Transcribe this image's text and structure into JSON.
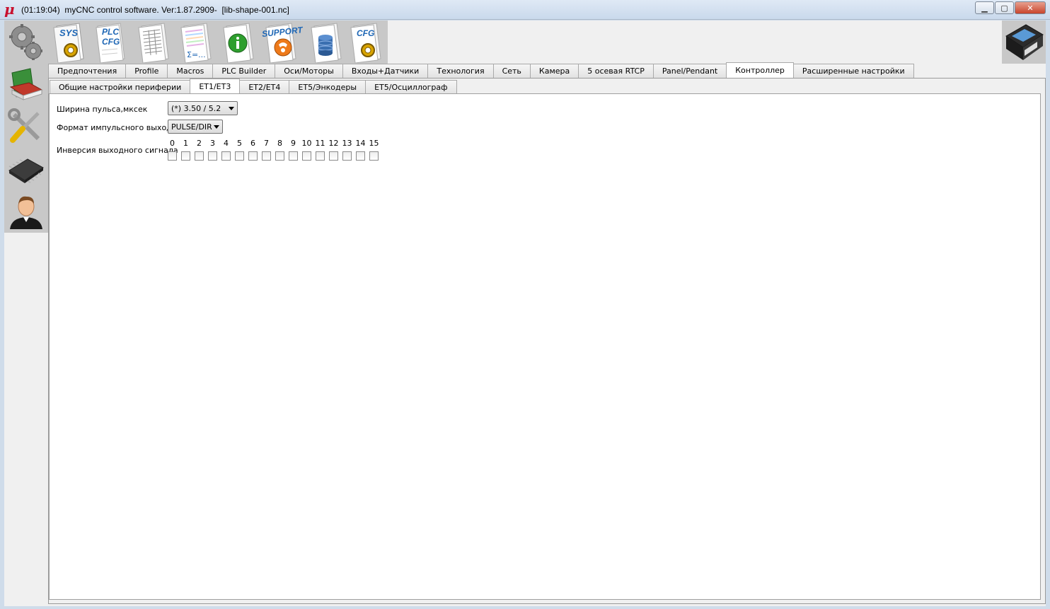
{
  "window": {
    "logo": "μ",
    "title": "(01:19:04)  myCNC control software. Ver:1.87.2909-  [lib-shape-001.nc]",
    "minimize": "▁",
    "maximize": "▢",
    "close": "✕"
  },
  "toolbar": {
    "items": [
      {
        "name": "sys-settings",
        "label": "SYS",
        "icon": "gear-icon"
      },
      {
        "name": "plc-cfg",
        "label": "PLC CFG",
        "icon": "document-icon"
      },
      {
        "name": "table-doc",
        "label": "",
        "icon": "table-icon"
      },
      {
        "name": "formula-doc",
        "label": "Σ=...",
        "icon": "formula-icon"
      },
      {
        "name": "info",
        "label": "",
        "icon": "info-icon"
      },
      {
        "name": "support",
        "label": "SUPPORT",
        "icon": "phone-icon"
      },
      {
        "name": "database",
        "label": "",
        "icon": "database-icon"
      },
      {
        "name": "cfg",
        "label": "CFG",
        "icon": "gear-icon"
      }
    ],
    "save_icon": "floppy-disk-icon"
  },
  "sidebar": {
    "items": [
      {
        "icon": "gears-icon"
      },
      {
        "icon": "book-icon"
      },
      {
        "icon": "tools-icon"
      },
      {
        "icon": "chip-icon"
      },
      {
        "icon": "user-icon"
      }
    ]
  },
  "main_tabs": [
    "Предпочтения",
    "Profile",
    "Macros",
    "PLC Builder",
    "Оси/Моторы",
    "Входы+Датчики",
    "Технология",
    "Сеть",
    "Камера",
    "5 осевая RTCP",
    "Panel/Pendant",
    "Контроллер",
    "Расширенные настройки"
  ],
  "main_tab_active": "Контроллер",
  "sub_tabs": [
    "Общие настройки периферии",
    "ET1/ET3",
    "ET2/ET4",
    "ET5/Энкодеры",
    "ET5/Осциллограф"
  ],
  "sub_tab_active": "ET1/ET3",
  "form": {
    "pulse_width_label": "Ширина пульса,мксек",
    "pulse_width_value": "(*) 3.50 / 5.2",
    "pulse_format_label": "Формат импульсного выхода",
    "pulse_format_value": "PULSE/DIR",
    "inversion_label": "Инверсия выходного сигнала",
    "bits": [
      "0",
      "1",
      "2",
      "3",
      "4",
      "5",
      "6",
      "7",
      "8",
      "9",
      "10",
      "11",
      "12",
      "13",
      "14",
      "15"
    ],
    "bits_checked": [
      false,
      false,
      false,
      false,
      false,
      false,
      false,
      false,
      false,
      false,
      false,
      false,
      false,
      false,
      false,
      false
    ]
  }
}
